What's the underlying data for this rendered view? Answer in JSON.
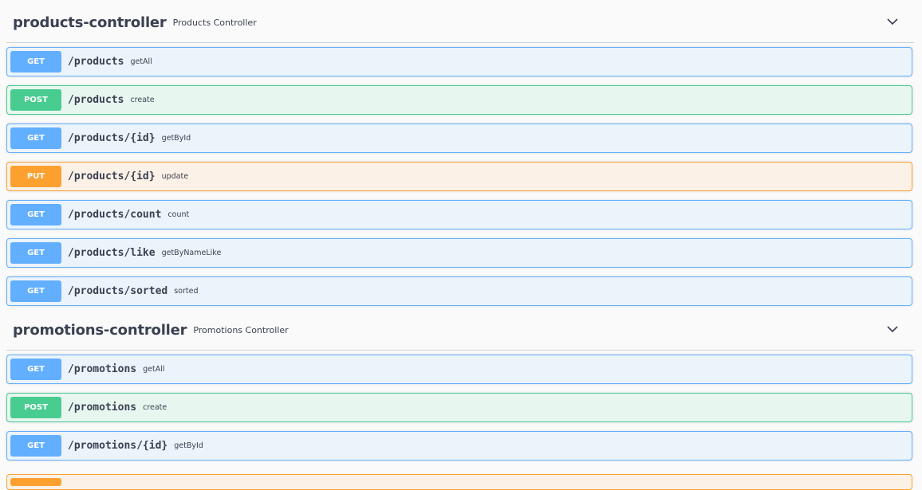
{
  "sections": [
    {
      "title": "products-controller",
      "description": "Products Controller",
      "chevron_icon": "chevron-down-icon",
      "operations": [
        {
          "method": "GET",
          "path": "/products",
          "summary": "getAll"
        },
        {
          "method": "POST",
          "path": "/products",
          "summary": "create"
        },
        {
          "method": "GET",
          "path": "/products/{id}",
          "summary": "getById"
        },
        {
          "method": "PUT",
          "path": "/products/{id}",
          "summary": "update"
        },
        {
          "method": "GET",
          "path": "/products/count",
          "summary": "count"
        },
        {
          "method": "GET",
          "path": "/products/like",
          "summary": "getByNameLike"
        },
        {
          "method": "GET",
          "path": "/products/sorted",
          "summary": "sorted"
        }
      ]
    },
    {
      "title": "promotions-controller",
      "description": "Promotions Controller",
      "chevron_icon": "chevron-down-icon",
      "operations": [
        {
          "method": "GET",
          "path": "/promotions",
          "summary": "getAll"
        },
        {
          "method": "POST",
          "path": "/promotions",
          "summary": "create"
        },
        {
          "method": "GET",
          "path": "/promotions/{id}",
          "summary": "getById"
        }
      ]
    }
  ],
  "colors": {
    "get": "#61affe",
    "post": "#49cc90",
    "put": "#fca130"
  }
}
